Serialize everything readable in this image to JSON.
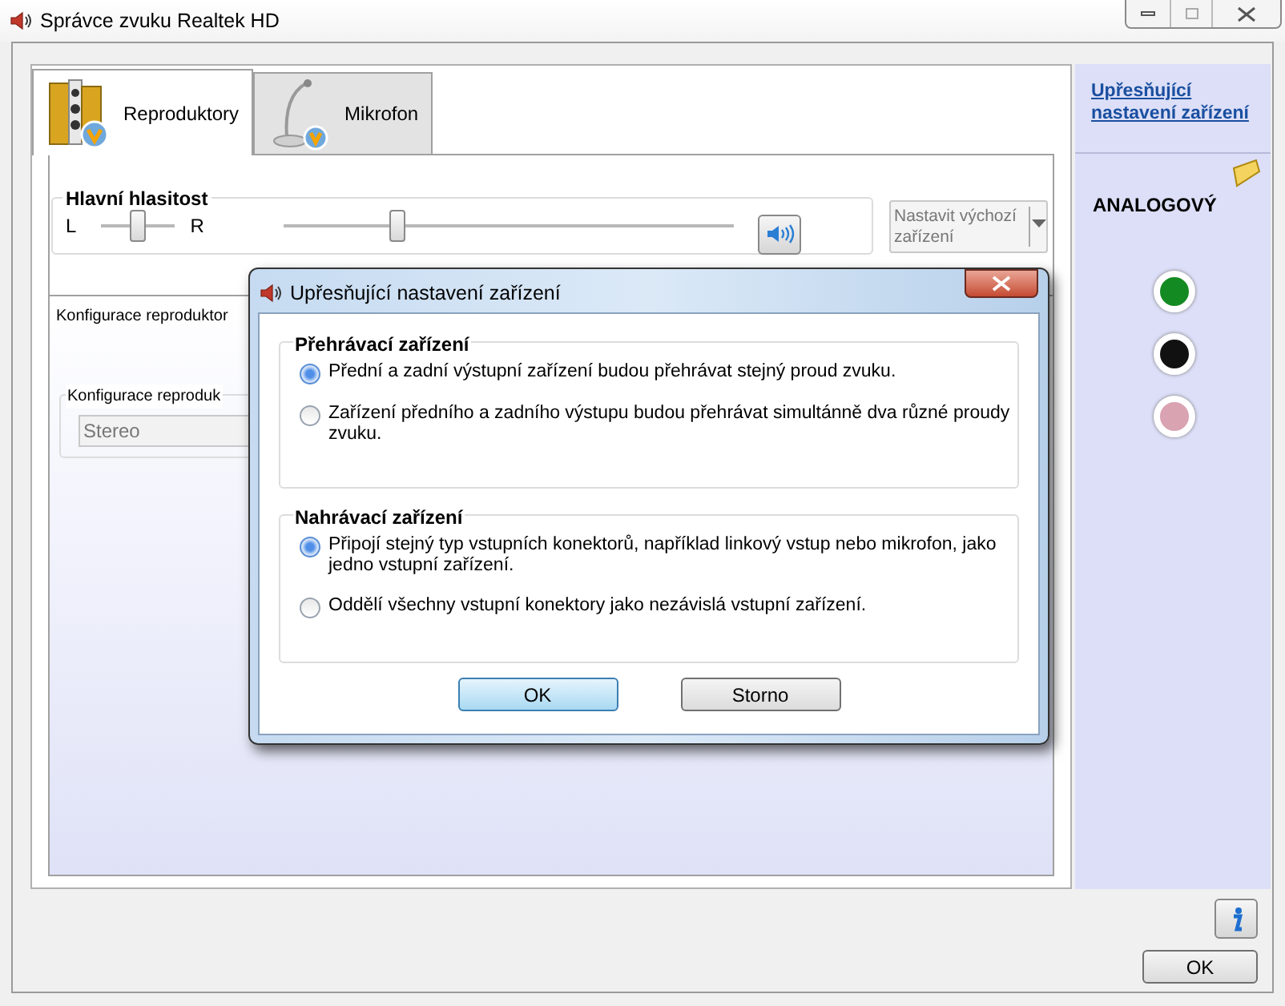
{
  "window": {
    "title": "Správce zvuku Realtek HD"
  },
  "tabs": [
    {
      "label": "Reproduktory",
      "selected": true,
      "kind": "speakers"
    },
    {
      "label": "Mikrofon",
      "selected": false,
      "kind": "microphone"
    }
  ],
  "master_volume": {
    "label": "Hlavní hlasitost",
    "left": "L",
    "right": "R",
    "balance": {
      "level": 0.5
    },
    "volume": {
      "level": 0.25
    }
  },
  "default_device": {
    "value": "Nastavit výchozí zařízení"
  },
  "speaker_config": {
    "title": "Konfigurace reproduktor",
    "group_label": "Konfigurace reproduk",
    "select_value": "Stereo"
  },
  "sidebar": {
    "link": "Upřesňující nastavení zařízení",
    "section": "ANALOGOVÝ",
    "jacks": [
      {
        "color": "#148a22"
      },
      {
        "color": "#111111"
      },
      {
        "color": "#d9a3b2"
      }
    ]
  },
  "buttons": [
    "OK"
  ],
  "dialog": {
    "title": "Upřesňující nastavení zařízení",
    "groups": [
      {
        "title": "Přehrávací zařízení",
        "options": [
          {
            "label": "Přední a zadní výstupní zařízení budou přehrávat stejný proud zvuku.",
            "selected": true
          },
          {
            "label": "Zařízení předního a zadního výstupu budou přehrávat simultánně dva různé proudy zvuku.",
            "selected": false
          }
        ]
      },
      {
        "title": "Nahrávací zařízení",
        "options": [
          {
            "label": "Připojí stejný typ vstupních konektorů, například linkový vstup nebo mikrofon, jako jedno vstupní zařízení.",
            "selected": true
          },
          {
            "label": "Oddělí všechny vstupní konektory jako nezávislá vstupní zařízení.",
            "selected": false
          }
        ]
      }
    ],
    "buttons": [
      {
        "label": "OK",
        "default": true
      },
      {
        "label": "Storno",
        "default": false
      }
    ]
  }
}
